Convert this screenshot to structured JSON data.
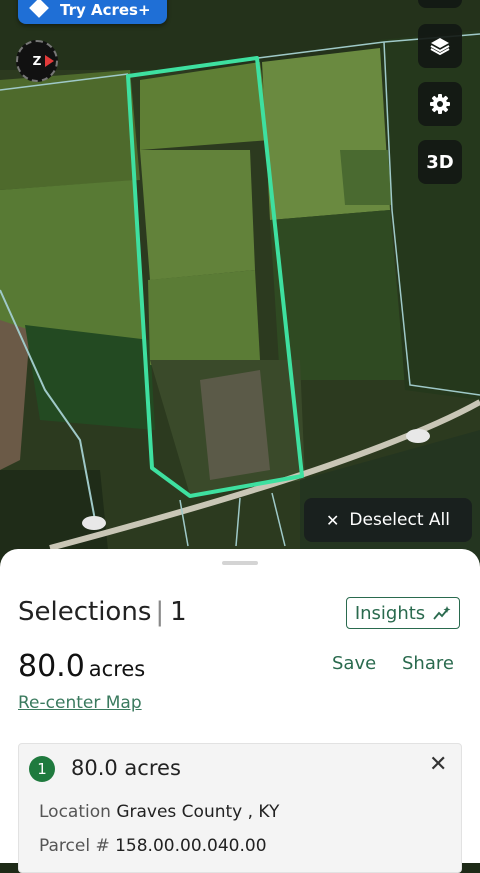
{
  "banner": {
    "try_label": "Try Acres+"
  },
  "compass": {
    "label": "Z"
  },
  "map_controls": {
    "three_d_label": "3D"
  },
  "deselect": {
    "icon": "✕",
    "label": "Deselect All"
  },
  "sheet": {
    "title": "Selections",
    "count": "1",
    "insights_label": "Insights",
    "total_acres": "80.0",
    "acres_unit": "acres",
    "save_label": "Save",
    "share_label": "Share",
    "recenter_label": "Re-center Map",
    "parcel": {
      "index": "1",
      "acres_text": "80.0 acres",
      "close_icon": "✕",
      "location_label": "Location",
      "location_value": "Graves County , KY",
      "parcel_label": "Parcel #",
      "parcel_value": "158.00.00.040.00"
    }
  },
  "colors": {
    "selection": "#3ee0a0",
    "accent": "#2a6a4e",
    "badge": "#1f7a3e",
    "try_button": "#1f6fd6"
  }
}
